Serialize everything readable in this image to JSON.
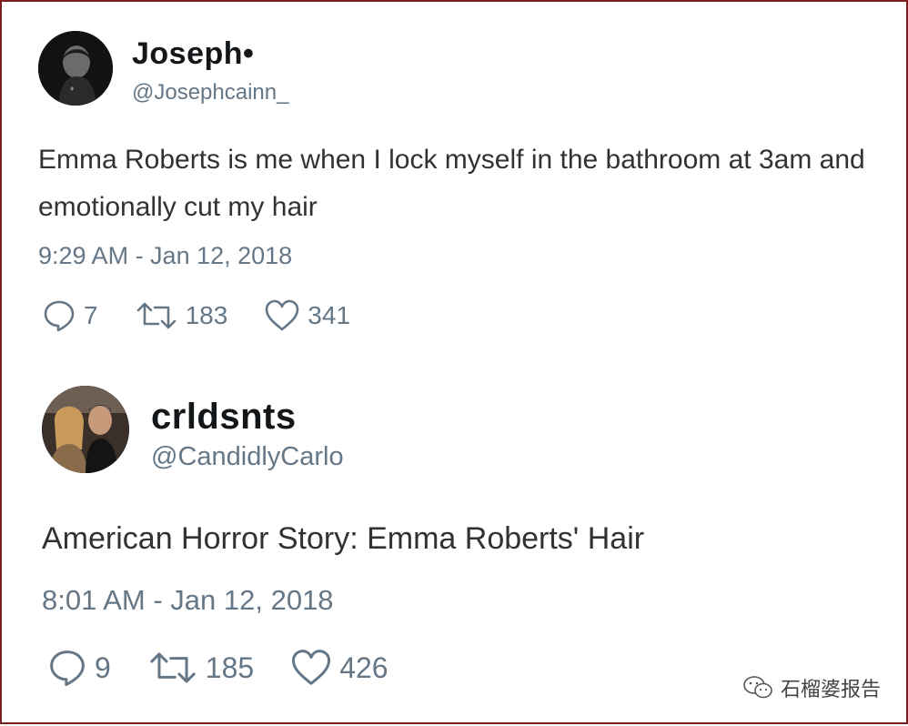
{
  "tweets": [
    {
      "name": "Joseph•",
      "handle": "@Josephcainn_",
      "avatar_icon": "profile-photo-dark",
      "text_line1": "Emma Roberts is me when I lock myself in the bathroom at 3am and",
      "text_line2": "emotionally cut my hair",
      "timestamp": "9:29 AM - Jan 12, 2018",
      "replies": "7",
      "retweets": "183",
      "likes": "341"
    },
    {
      "name": "crldsnts",
      "handle": "@CandidlyCarlo",
      "avatar_icon": "profile-photo-couple",
      "text_line1": "American Horror Story: Emma Roberts' Hair",
      "timestamp": "8:01 AM - Jan 12, 2018",
      "replies": "9",
      "retweets": "185",
      "likes": "426"
    }
  ],
  "watermark": {
    "text": "石榴婆报告",
    "icon": "wechat-icon"
  },
  "colors": {
    "border": "#7a1f1f",
    "name": "#14171a",
    "muted": "#657786",
    "body": "#2f3336"
  }
}
